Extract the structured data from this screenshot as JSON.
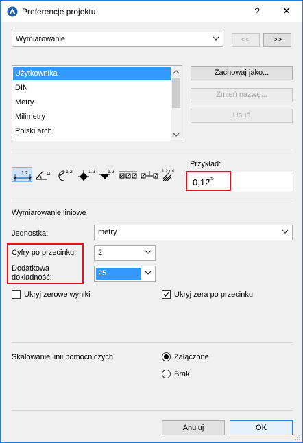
{
  "window": {
    "title": "Preferencje projektu",
    "help_glyph": "?",
    "close_glyph": "✕"
  },
  "category_select": {
    "value": "Wymiarowanie"
  },
  "nav": {
    "prev_label": "<<",
    "next_label": ">>"
  },
  "presets": {
    "items": [
      {
        "label": "Użytkownika",
        "selected": true
      },
      {
        "label": "DIN",
        "selected": false
      },
      {
        "label": "Metry",
        "selected": false
      },
      {
        "label": "Milimetry",
        "selected": false
      },
      {
        "label": "Polski arch.",
        "selected": false
      }
    ]
  },
  "preset_buttons": {
    "save_as": "Zachowaj jako...",
    "rename": "Zmień nazwę...",
    "delete": "Usuń"
  },
  "dimension_types": [
    {
      "icon": "linear-dimension-icon",
      "label": "1.2",
      "active": true
    },
    {
      "icon": "angular-dimension-icon",
      "label": "α",
      "active": false
    },
    {
      "icon": "radial-dimension-icon",
      "label": "1.2",
      "active": false
    },
    {
      "icon": "level-dimension-icon",
      "label": "1.2",
      "active": false
    },
    {
      "icon": "elevation-dimension-icon",
      "label": "1.2",
      "active": false
    },
    {
      "icon": "door-window-dimension-icon",
      "label": "",
      "active": false
    },
    {
      "icon": "sill-height-dimension-icon",
      "label": "",
      "active": false
    },
    {
      "icon": "area-dimension-icon",
      "label": "1.2 m²",
      "active": false
    }
  ],
  "example": {
    "label": "Przykład:",
    "value_main": "0,12",
    "value_sup": "25"
  },
  "section_title": "Wymiarowanie liniowe",
  "fields": {
    "unit_label": "Jednostka:",
    "unit_value": "metry",
    "decimals_label": "Cyfry po przecinku:",
    "decimals_value": "2",
    "extra_precision_label_1": "Dodatkowa",
    "extra_precision_label_2": "dokładność:",
    "extra_precision_value": "25"
  },
  "checkboxes": {
    "hide_zero_results": {
      "label": "Ukryj zerowe wyniki",
      "checked": false
    },
    "hide_trailing_zeros": {
      "label": "Ukryj zera po przecinku",
      "checked": true
    }
  },
  "guide_scaling": {
    "label": "Skalowanie linii pomocniczych:",
    "options": [
      {
        "label": "Załączone",
        "selected": true
      },
      {
        "label": "Brak",
        "selected": false
      }
    ]
  },
  "footer": {
    "cancel": "Anuluj",
    "ok": "OK"
  },
  "colors": {
    "accent": "#2b7bd8",
    "selection": "#3399ff",
    "highlight_red": "#e8101a"
  }
}
